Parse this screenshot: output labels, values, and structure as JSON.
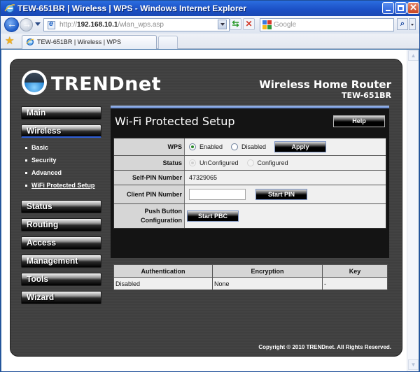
{
  "browser": {
    "window_title": "TEW-651BR | Wireless | WPS - Windows Internet Explorer",
    "url_prefix": "http://",
    "url_host": "192.168.10.1",
    "url_path": "/wlan_wps.asp",
    "search_placeholder": "Google",
    "tab_label": "TEW-651BR | Wireless | WPS",
    "close_glyph": "✕"
  },
  "header": {
    "brand": "TRENDnet",
    "product_name": "Wireless Home Router",
    "model": "TEW-651BR"
  },
  "sidebar": {
    "items": [
      {
        "label": "Main"
      },
      {
        "label": "Wireless",
        "active": true,
        "subitems": [
          {
            "label": "Basic"
          },
          {
            "label": "Security"
          },
          {
            "label": "Advanced"
          },
          {
            "label": "WiFi Protected Setup",
            "current": true
          }
        ]
      },
      {
        "label": "Status"
      },
      {
        "label": "Routing"
      },
      {
        "label": "Access"
      },
      {
        "label": "Management"
      },
      {
        "label": "Tools"
      },
      {
        "label": "Wizard"
      }
    ]
  },
  "panel": {
    "title": "Wi-Fi Protected Setup",
    "help_label": "Help",
    "wps": {
      "label": "WPS",
      "options": [
        "Enabled",
        "Disabled"
      ],
      "selected": "Enabled",
      "apply_label": "Apply"
    },
    "status": {
      "label": "Status",
      "options": [
        "UnConfigured",
        "Configured"
      ],
      "selected": "UnConfigured"
    },
    "self_pin": {
      "label": "Self-PIN Number",
      "value": "47329065"
    },
    "client_pin": {
      "label": "Client PIN Number",
      "value": "",
      "button_label": "Start PIN"
    },
    "pbc": {
      "label_line1": "Push Button",
      "label_line2": "Configuration",
      "button_label": "Start PBC"
    }
  },
  "security_table": {
    "headers": [
      "Authentication",
      "Encryption",
      "Key"
    ],
    "rows": [
      [
        "Disabled",
        "None",
        "-"
      ]
    ]
  },
  "footer": {
    "copyright": "Copyright © 2010 TRENDnet. All Rights Reserved."
  },
  "colors": {
    "accent_blue": "#6b90d8",
    "page_bg": "#434343",
    "panel_bg": "#141414"
  }
}
